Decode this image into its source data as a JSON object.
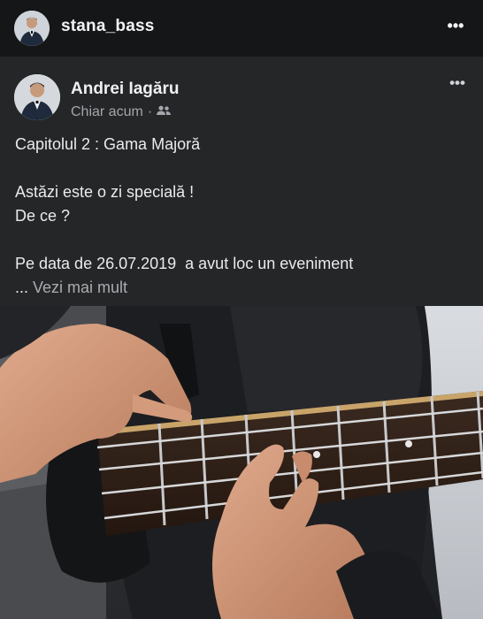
{
  "header": {
    "username": "stana_bass",
    "more_icon": "more-horizontal-icon"
  },
  "post": {
    "author": "Andrei Iagăru",
    "time": "Chiar acum",
    "separator": "·",
    "audience_icon": "friends-icon",
    "more_icon": "more-horizontal-icon",
    "lines": [
      "Capitolul 2 : Gama Majoră",
      "",
      "Astăzi este o zi specială !",
      "De ce ?",
      "",
      "Pe data de 26.07.2019  a avut loc un eveniment"
    ],
    "see_more_prefix": "... ",
    "see_more": "Vezi mai mult"
  },
  "colors": {
    "background": "#1c1d1f",
    "card": "#252628",
    "text": "#e9ebee",
    "secondary_text": "#a3a6ab"
  }
}
